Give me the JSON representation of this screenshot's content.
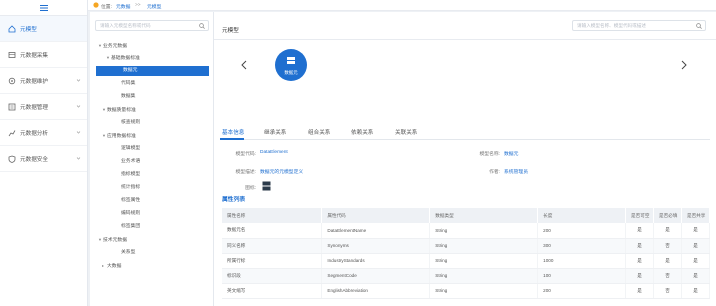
{
  "nav": {
    "items": [
      {
        "label": "元模型"
      },
      {
        "label": "元数据采集"
      },
      {
        "label": "元数据维护"
      },
      {
        "label": "元数据管理"
      },
      {
        "label": "元数据分析"
      },
      {
        "label": "元数据安全"
      }
    ]
  },
  "breadcrumb": {
    "location_label": "位置:",
    "level1": "元数据",
    "separator": ">>",
    "level2": "元模型"
  },
  "tree": {
    "search_placeholder": "请输入元模型名称或代码",
    "nodes": [
      {
        "label": "业务元数据",
        "caret": "▼"
      },
      {
        "label": "基础数据标准",
        "caret": "▼"
      },
      {
        "label": "数据元",
        "caret": ""
      },
      {
        "label": "代码集",
        "caret": ""
      },
      {
        "label": "数据集",
        "caret": ""
      },
      {
        "label": "数据质量标准",
        "caret": "▼"
      },
      {
        "label": "核查规则",
        "caret": ""
      },
      {
        "label": "应用数据标准",
        "caret": "▼"
      },
      {
        "label": "逻辑模型",
        "caret": ""
      },
      {
        "label": "业务术语",
        "caret": ""
      },
      {
        "label": "指标模型",
        "caret": ""
      },
      {
        "label": "统计指标",
        "caret": ""
      },
      {
        "label": "标签属性",
        "caret": ""
      },
      {
        "label": "编码规则",
        "caret": ""
      },
      {
        "label": "标签集团",
        "caret": ""
      },
      {
        "label": "技术元数据",
        "caret": "▼"
      },
      {
        "label": "关系型",
        "caret": ""
      },
      {
        "label": "大数据",
        "caret": "▸"
      }
    ]
  },
  "main": {
    "title": "元模型",
    "search_placeholder": "请输入模型名称、模型代码或描述",
    "card": {
      "name": "数据元"
    },
    "tabs": [
      {
        "label": "基本信息"
      },
      {
        "label": "继承关系"
      },
      {
        "label": "组合关系"
      },
      {
        "label": "依赖关系"
      },
      {
        "label": "关联关系"
      }
    ],
    "info": {
      "code_label": "模型代码:",
      "code_value": "DataElement",
      "name_label": "模型名称:",
      "name_value": "数据元",
      "desc_label": "模型描述:",
      "desc_value": "数据元的元模型定义",
      "author_label": "作者:",
      "author_value": "系统管理员",
      "icon_label": "图标:"
    },
    "attr_title": "属性列表",
    "table": {
      "headers": [
        "属性名称",
        "属性代码",
        "数据类型",
        "长度",
        "是否可空",
        "是否必填",
        "是否共享"
      ],
      "rows": [
        [
          "数据元名",
          "DataElementName",
          "String",
          "200",
          "是",
          "是",
          "是"
        ],
        [
          "同义名称",
          "Synonyms",
          "String",
          "300",
          "是",
          "否",
          "是"
        ],
        [
          "所属行标",
          "IndustryStandards",
          "String",
          "1000",
          "是",
          "是",
          "是"
        ],
        [
          "标识段",
          "SegmentCode",
          "String",
          "100",
          "是",
          "否",
          "是"
        ],
        [
          "英文缩写",
          "EnglishAbbreviation",
          "String",
          "200",
          "是",
          "否",
          "是"
        ]
      ]
    }
  },
  "colors": {
    "accent": "#1f6fd0",
    "selected_bg": "#1f6fd0",
    "page_bg": "#eef1f5"
  }
}
